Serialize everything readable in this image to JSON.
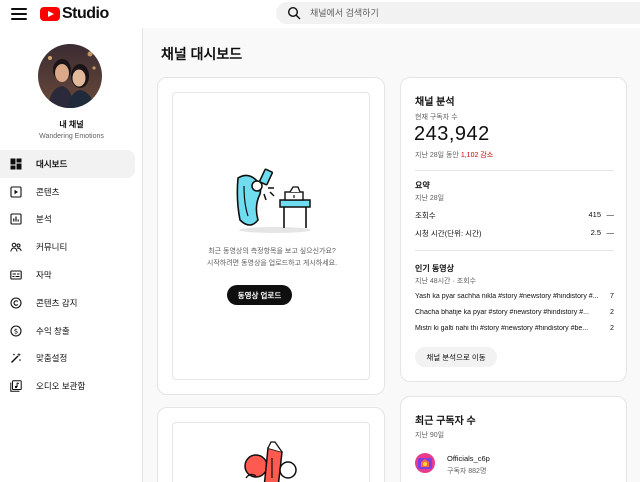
{
  "app": {
    "logo_text": "Studio"
  },
  "search": {
    "placeholder": "채널에서 검색하기"
  },
  "sidebar": {
    "channel_label": "내 채널",
    "channel_name": "Wandering Emotions",
    "items": [
      {
        "label": "대시보드",
        "icon": "dashboard-icon"
      },
      {
        "label": "콘텐츠",
        "icon": "content-icon"
      },
      {
        "label": "분석",
        "icon": "analytics-icon"
      },
      {
        "label": "커뮤니티",
        "icon": "community-icon"
      },
      {
        "label": "자막",
        "icon": "subtitles-icon"
      },
      {
        "label": "콘텐츠 감지",
        "icon": "copyright-icon"
      },
      {
        "label": "수익 창출",
        "icon": "monetization-icon"
      },
      {
        "label": "맞춤설정",
        "icon": "customization-icon"
      },
      {
        "label": "오디오 보관함",
        "icon": "audio-library-icon"
      }
    ]
  },
  "main": {
    "title": "채널 대시보드",
    "upload_card": {
      "line1": "최근 동영상의 측정항목을 보고 싶으신가요?",
      "line2": "시작하려면 동영상을 업로드하고 게시하세요.",
      "button": "동영상 업로드"
    }
  },
  "analytics": {
    "title": "채널 분석",
    "current_subs_label": "현재 구독자 수",
    "current_subs": "243,942",
    "change_prefix": "지난 28일 동안",
    "change_value": "1,102 감소",
    "summary_title": "요약",
    "summary_period": "지난 28일",
    "rows": [
      {
        "label": "조회수",
        "value": "415",
        "trend": "—"
      },
      {
        "label": "시청 시간(단위: 시간)",
        "value": "2.5",
        "trend": "—"
      }
    ],
    "top_videos_title": "인기 동영상",
    "top_videos_period": "지난 48시간 · 조회수",
    "videos": [
      {
        "title": "Yash ka pyar sachha nikla #story #newstory #hindistory #...",
        "views": "7"
      },
      {
        "title": "Chacha bhatije ka pyar #story #newstory #hindistory #...",
        "views": "2"
      },
      {
        "title": "Mistri ki galti nahi thi #story #newstory #hindistory #be...",
        "views": "2"
      }
    ],
    "go_button": "채널 분석으로 이동"
  },
  "recent_subs": {
    "title": "최근 구독자 수",
    "period": "지난 90일",
    "subscriber": {
      "name": "Officials_c6p",
      "count": "구독자 882명"
    }
  },
  "colors": {
    "brand_red": "#ff0000",
    "text": "#0f0f0f",
    "muted": "#606060",
    "decrease": "#cc0000"
  }
}
